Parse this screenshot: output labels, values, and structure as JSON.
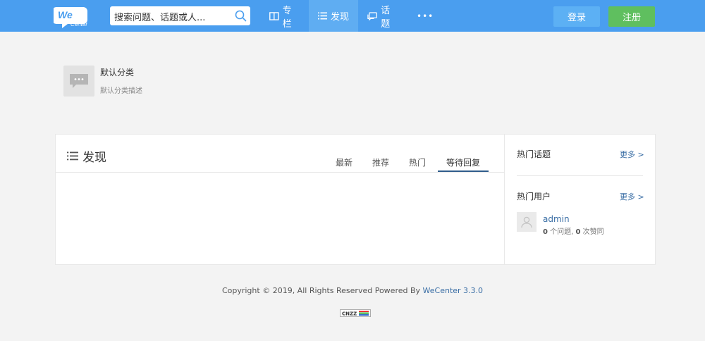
{
  "header": {
    "logo_top": "We",
    "logo_bottom": "Center",
    "search_placeholder": "搜索问题、话题或人...",
    "nav": [
      {
        "label": "专栏"
      },
      {
        "label": "发现"
      },
      {
        "label": "话题"
      },
      {
        "label": "•••"
      }
    ],
    "login_label": "登录",
    "register_label": "注册",
    "colors": {
      "bar": "#4a9eef",
      "register": "#5fbf5f"
    }
  },
  "category": {
    "title": "默认分类",
    "description": "默认分类描述"
  },
  "main": {
    "title": "发现",
    "tabs": [
      {
        "label": "最新"
      },
      {
        "label": "推荐"
      },
      {
        "label": "热门"
      },
      {
        "label": "等待回复",
        "active": true
      }
    ]
  },
  "sidebar": {
    "hot_topics": {
      "title": "热门话题",
      "more": "更多 >"
    },
    "hot_users": {
      "title": "热门用户",
      "more": "更多 >"
    },
    "user": {
      "name": "admin",
      "questions_count": "0",
      "questions_suffix": " 个问题, ",
      "likes_count": "0",
      "likes_suffix": " 次赞同"
    }
  },
  "footer": {
    "copyright": "Copyright © 2019, All Rights Reserved Powered By ",
    "brand": "WeCenter 3.3.0",
    "badge": "CNZZ"
  }
}
